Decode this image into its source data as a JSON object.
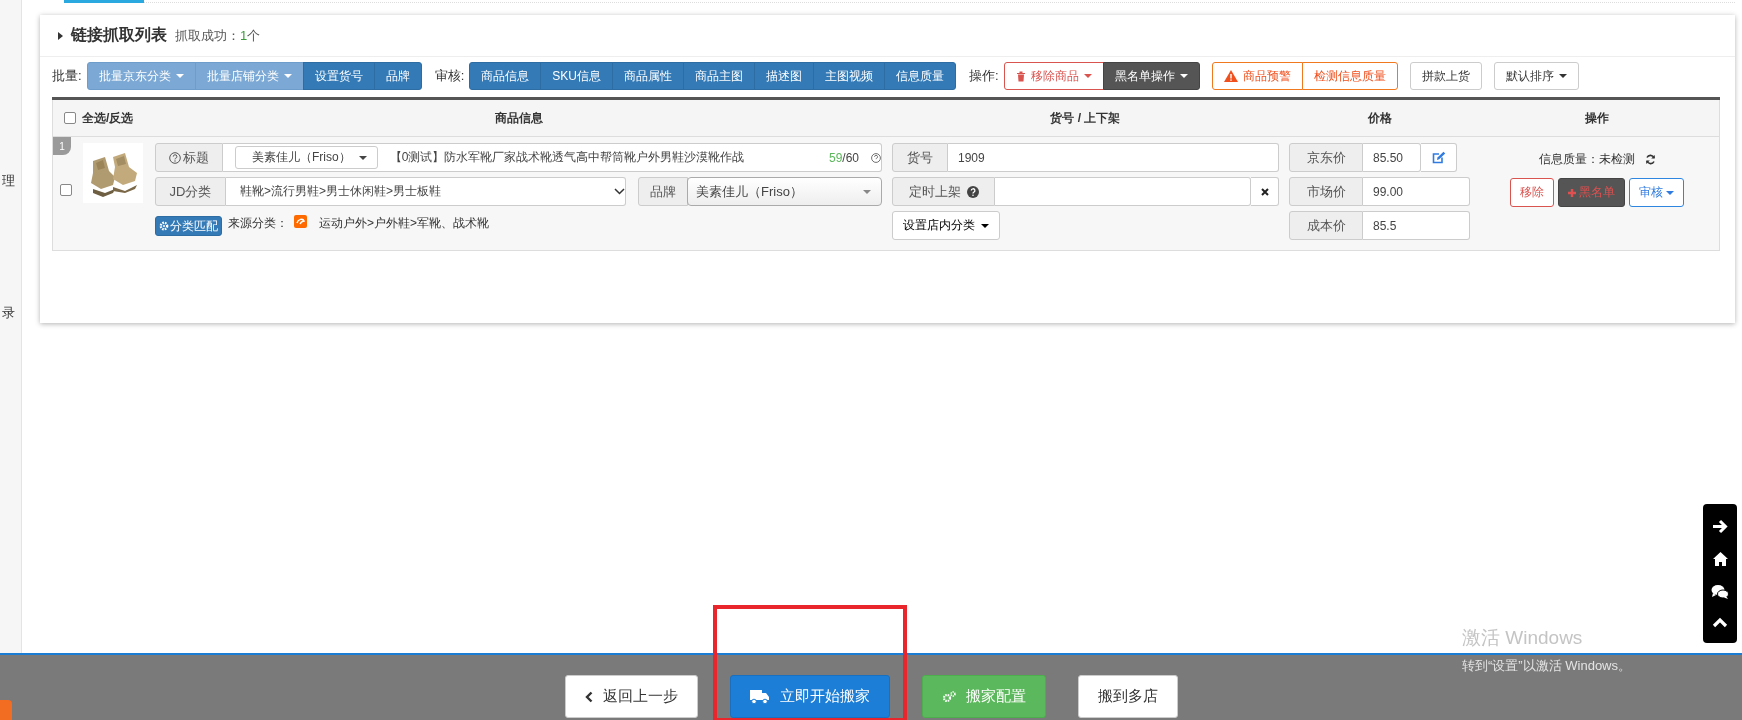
{
  "sidebar": {
    "items": [
      {
        "label": "理"
      },
      {
        "label": "录"
      }
    ]
  },
  "panel": {
    "title": "链接抓取列表",
    "success_label": "抓取成功：",
    "success_count": "1",
    "success_unit": "个"
  },
  "toolbar": {
    "groups": [
      {
        "label": "批量:",
        "buttons": [
          {
            "label": "批量京东分类",
            "kind": "light",
            "caret": true
          },
          {
            "label": "批量店铺分类",
            "kind": "light",
            "caret": true
          },
          {
            "label": "设置货号",
            "kind": "primary",
            "caret": false
          },
          {
            "label": "品牌",
            "kind": "primary",
            "caret": false
          }
        ]
      },
      {
        "label": "审核:",
        "buttons": [
          {
            "label": "商品信息",
            "kind": "primary",
            "caret": false
          },
          {
            "label": "SKU信息",
            "kind": "primary",
            "caret": false
          },
          {
            "label": "商品属性",
            "kind": "primary",
            "caret": false
          },
          {
            "label": "商品主图",
            "kind": "primary",
            "caret": false
          },
          {
            "label": "描述图",
            "kind": "primary",
            "caret": false
          },
          {
            "label": "主图视频",
            "kind": "primary",
            "caret": false
          },
          {
            "label": "信息质量",
            "kind": "primary",
            "caret": false
          }
        ]
      },
      {
        "label": "操作:",
        "buttons": [
          {
            "label": "移除商品",
            "kind": "danger",
            "caret": true
          },
          {
            "label": "黑名单操作",
            "kind": "dark",
            "caret": true
          }
        ]
      },
      {
        "buttons": [
          {
            "label": "商品预警",
            "kind": "alert",
            "caret": false
          },
          {
            "label": "检测信息质量",
            "kind": "warning",
            "caret": false
          }
        ]
      },
      {
        "buttons": [
          {
            "label": "拼款上货",
            "kind": "default",
            "caret": false
          }
        ]
      },
      {
        "buttons": [
          {
            "label": "默认排序",
            "kind": "default",
            "caret": true
          }
        ]
      }
    ]
  },
  "table": {
    "select_all": {
      "label": "全选/反选",
      "checked": false
    },
    "columns": [
      "商品信息",
      "货号 / 上下架",
      "价格",
      "操作"
    ],
    "rows": [
      {
        "index": "1",
        "checked": false,
        "title_label": "标题",
        "shop": "美素佳儿（Friso）",
        "title": "【0测试】防水军靴厂家战术靴透气高中帮筒靴户外男鞋沙漠靴作战",
        "count_used": "59",
        "count_total": "/60",
        "jd_label": "JD分类",
        "jd_category": "鞋靴>流行男鞋>男士休闲鞋>男士板鞋",
        "brand_label": "品牌",
        "brand": "美素佳儿（Friso）",
        "match_button": "分类匹配",
        "source_label": "来源分类：",
        "source_category": "运动户外>户外鞋>军靴、战术靴",
        "sku_label": "货号",
        "sku": "1909",
        "schedule_label": "定时上架",
        "shop_category_button": "设置店内分类",
        "prices": [
          {
            "label": "京东价",
            "value": "85.50",
            "editable": true
          },
          {
            "label": "市场价",
            "value": "99.00",
            "editable": false
          },
          {
            "label": "成本价",
            "value": "85.5",
            "editable": false
          }
        ],
        "quality_label": "信息质量：",
        "quality": "未检测",
        "actions": [
          {
            "label": "移除",
            "kind": "remove"
          },
          {
            "label": "黑名单",
            "kind": "blacklist"
          },
          {
            "label": "审核",
            "kind": "review"
          }
        ]
      }
    ]
  },
  "bottom_bar": {
    "buttons": [
      {
        "label": "返回上一步",
        "kind": "back",
        "highlighted": false
      },
      {
        "label": "立即开始搬家",
        "kind": "primary",
        "highlighted": true
      },
      {
        "label": "搬家配置",
        "kind": "config",
        "highlighted": false
      },
      {
        "label": "搬到多店",
        "kind": "plain",
        "highlighted": false
      }
    ]
  },
  "activation": {
    "title": "激活 Windows",
    "hint": "转到“设置”以激活 Windows。"
  }
}
